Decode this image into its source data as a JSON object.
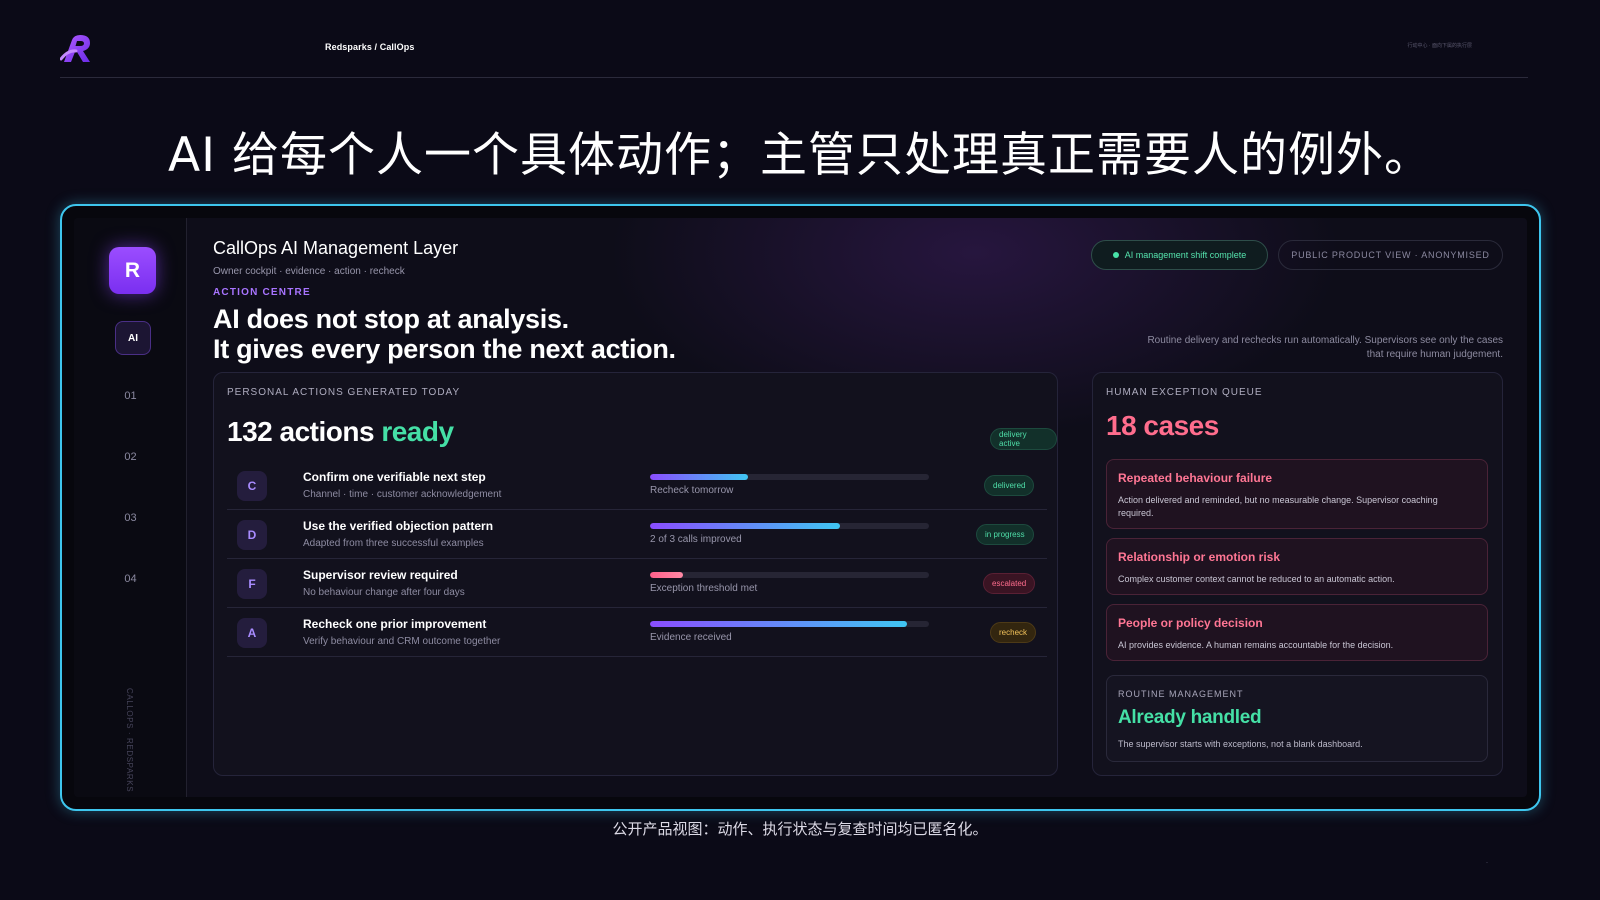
{
  "header": {
    "brand_path": "Redsparks / CallOps",
    "corner_note": "行动中心 · 面向下属的执行层"
  },
  "slide_title": "AI 给每个人一个具体动作；主管只处理真正需要人的例外。",
  "caption": "公开产品视图：动作、执行状态与复查时间均已匿名化。",
  "page_marker": "-",
  "rail": {
    "logo_letter": "R",
    "ai_label": "AI",
    "items": [
      "01",
      "02",
      "03",
      "04"
    ],
    "vertical_text": "CALLOPS · REDSPARKS"
  },
  "app": {
    "title": "CallOps AI Management Layer",
    "subtitle": "Owner cockpit · evidence · action · recheck",
    "section_label": "ACTION CENTRE",
    "headline_1": "AI does not stop at analysis.",
    "headline_2": "It gives every person the next action.",
    "status_pill": "AI management shift complete",
    "public_pill": "PUBLIC PRODUCT VIEW · ANONYMISED",
    "routine_note_1": "Routine delivery and rechecks run automatically. Supervisors see only the cases",
    "routine_note_2": "that require human judgement."
  },
  "actions_panel": {
    "label": "PERSONAL ACTIONS GENERATED TODAY",
    "count": "132 actions",
    "count_accent": "ready",
    "badge": "delivery active",
    "rows": [
      {
        "avatar": "C",
        "title": "Confirm one verifiable next step",
        "sub": "Channel · time · customer acknowledgement",
        "progress": 0.35,
        "progress_label": "Recheck tomorrow",
        "badge": "delivered",
        "tone": "green"
      },
      {
        "avatar": "D",
        "title": "Use the verified objection pattern",
        "sub": "Adapted from three successful examples",
        "progress": 0.68,
        "progress_label": "2 of 3 calls improved",
        "badge": "in progress",
        "tone": "green"
      },
      {
        "avatar": "F",
        "title": "Supervisor review required",
        "sub": "No behaviour change after four days",
        "progress": 0.12,
        "progress_label": "Exception threshold met",
        "badge": "escalated",
        "tone": "red"
      },
      {
        "avatar": "A",
        "title": "Recheck one prior improvement",
        "sub": "Verify behaviour and CRM outcome together",
        "progress": 0.92,
        "progress_label": "Evidence received",
        "badge": "recheck",
        "tone": "amber"
      }
    ]
  },
  "exceptions_panel": {
    "label": "HUMAN EXCEPTION QUEUE",
    "count": "18 cases",
    "cards": [
      {
        "title": "Repeated behaviour failure",
        "body": "Action delivered and reminded, but no measurable change. Supervisor coaching required."
      },
      {
        "title": "Relationship or emotion risk",
        "body": "Complex customer context cannot be reduced to an automatic action."
      },
      {
        "title": "People or policy decision",
        "body": "AI provides evidence. A human remains accountable for the decision."
      }
    ],
    "routine": {
      "label": "ROUTINE MANAGEMENT",
      "headline": "Already handled",
      "body": "The supervisor starts with exceptions, not a blank dashboard."
    }
  },
  "colors": {
    "accent_purple": "#9b4dff",
    "accent_green": "#45e0a6",
    "accent_red": "#ff6d8d",
    "frame_cyan": "#3ec6ee"
  }
}
